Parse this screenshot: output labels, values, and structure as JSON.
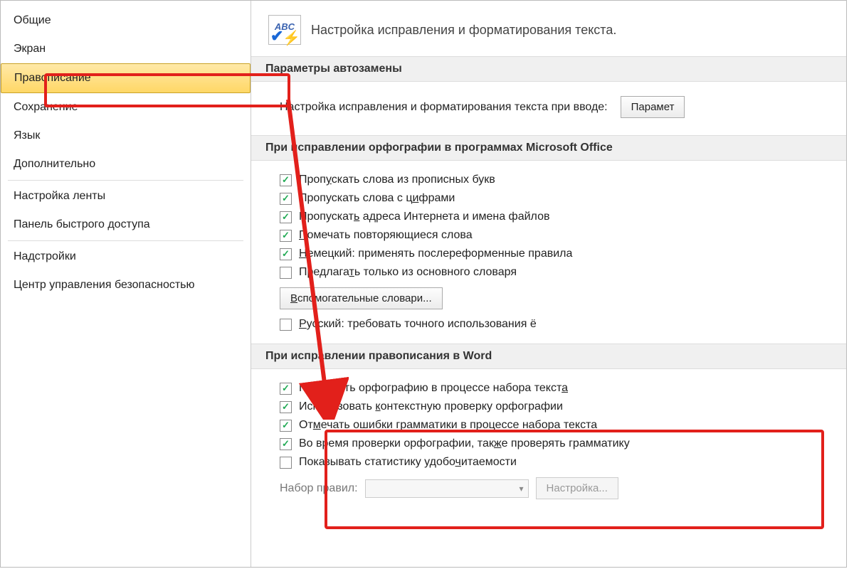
{
  "sidebar": {
    "items": [
      {
        "label": "Общие"
      },
      {
        "label": "Экран"
      },
      {
        "label": "Правописание",
        "selected": true
      },
      {
        "label": "Сохранение"
      },
      {
        "label": "Язык"
      },
      {
        "label": "Дополнительно"
      },
      {
        "label": "Настройка ленты"
      },
      {
        "label": "Панель быстрого доступа"
      },
      {
        "label": "Надстройки"
      },
      {
        "label": "Центр управления безопасностью"
      }
    ]
  },
  "header": {
    "icon_text": "ABC",
    "title": "Настройка исправления и форматирования текста."
  },
  "autocorrect": {
    "section_title": "Параметры автозамены",
    "desc": "Настройка исправления и форматирования текста при вводе:",
    "button": "Парамет"
  },
  "office": {
    "section_title": "При исправлении орфографии в программах Microsoft Office",
    "checkboxes": [
      {
        "checked": true,
        "pre": "Проп",
        "u": "у",
        "post": "скать слова из прописных букв"
      },
      {
        "checked": true,
        "pre": "Пропускать слова с ц",
        "u": "и",
        "post": "фрами"
      },
      {
        "checked": true,
        "pre": "Пропускат",
        "u": "ь",
        "post": " адреса Интернета и имена файлов"
      },
      {
        "checked": true,
        "pre": "",
        "u": "П",
        "post": "омечать повторяющиеся слова"
      },
      {
        "checked": true,
        "pre": "",
        "u": "Н",
        "post": "емецкий: применять послереформенные правила"
      },
      {
        "checked": false,
        "pre": "Предлага",
        "u": "т",
        "post": "ь только из основного словаря"
      }
    ],
    "dict_button": "Вспомогательные словари...",
    "russian": {
      "checked": false,
      "pre": "",
      "u": "Р",
      "post": "усский: требовать точного использования ё"
    }
  },
  "word": {
    "section_title": "При исправлении правописания в Word",
    "checkboxes": [
      {
        "checked": true,
        "pre": "Проверять орфографию в процессе набора текст",
        "u": "а",
        "post": ""
      },
      {
        "checked": true,
        "pre": "Использовать ",
        "u": "к",
        "post": "онтекстную проверку орфографии"
      },
      {
        "checked": true,
        "pre": "От",
        "u": "м",
        "post": "ечать ошибки грамматики в процессе набора текста"
      },
      {
        "checked": true,
        "pre": "Во время проверки орфографии, так",
        "u": "ж",
        "post": "е проверять грамматику"
      },
      {
        "checked": false,
        "pre": "Показывать статистику удобо",
        "u": "ч",
        "post": "итаемости"
      }
    ],
    "ruleset_label": "Набор правил:",
    "ruleset_value": "",
    "settings_button": "Настройка..."
  }
}
